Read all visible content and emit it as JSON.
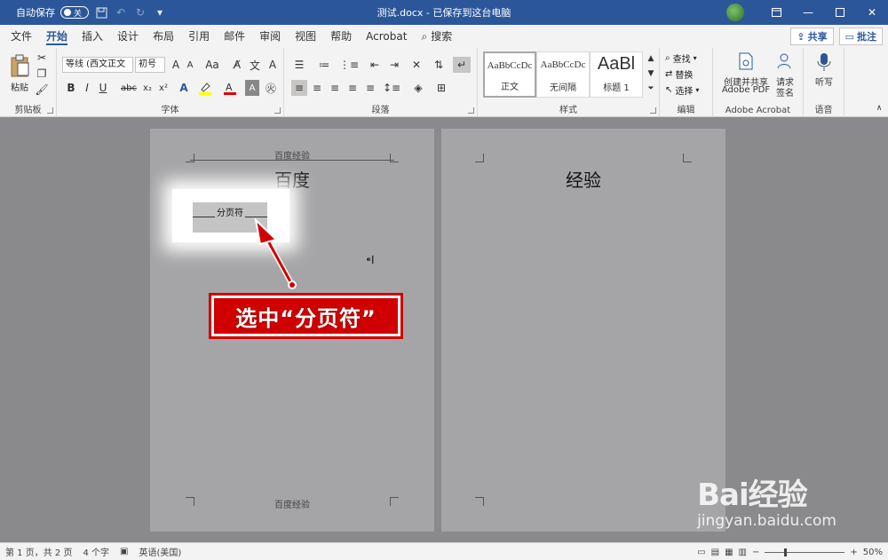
{
  "titlebar": {
    "autosave_label": "自动保存",
    "autosave_state": "关",
    "title": "测试.docx - 已保存到这台电脑"
  },
  "menu": {
    "tabs": [
      "文件",
      "开始",
      "插入",
      "设计",
      "布局",
      "引用",
      "邮件",
      "审阅",
      "视图",
      "帮助",
      "Acrobat"
    ],
    "active": "开始",
    "search": "搜索",
    "share": "共享",
    "comment": "批注"
  },
  "ribbon": {
    "clipboard": {
      "paste": "粘贴",
      "label": "剪贴板"
    },
    "font": {
      "name": "等线 (西文正文",
      "size": "初号",
      "label": "字体"
    },
    "paragraph": {
      "label": "段落"
    },
    "styles": {
      "label": "样式",
      "items": [
        {
          "sample": "AaBbCcDc",
          "name": "正文"
        },
        {
          "sample": "AaBbCcDc",
          "name": "无间隔"
        },
        {
          "sample": "AaBl",
          "name": "标题 1"
        }
      ]
    },
    "editing": {
      "find": "查找",
      "replace": "替换",
      "select": "选择",
      "label": "编辑"
    },
    "acrobat": {
      "create_line1": "创建并共享",
      "create_line2": "Adobe PDF",
      "request_line1": "请求",
      "request_line2": "签名",
      "label": "Adobe Acrobat"
    },
    "voice": {
      "dictate": "听写",
      "label": "语音"
    }
  },
  "document": {
    "page1": {
      "header": "百度经验",
      "heading": "百度",
      "page_break": "分页符",
      "footer": "百度经验"
    },
    "page2": {
      "heading": "经验"
    }
  },
  "annotation": {
    "callout": "选中“分页符”"
  },
  "watermark": {
    "logo": "Bai经验",
    "url": "jingyan.baidu.com"
  },
  "statusbar": {
    "page": "第 1 页，共 2 页",
    "words": "4 个字",
    "language": "英语(美国)",
    "zoom": "50%",
    "zoom_level": 0.5
  },
  "colors": {
    "accent": "#2b579a",
    "callout": "#d10000"
  }
}
